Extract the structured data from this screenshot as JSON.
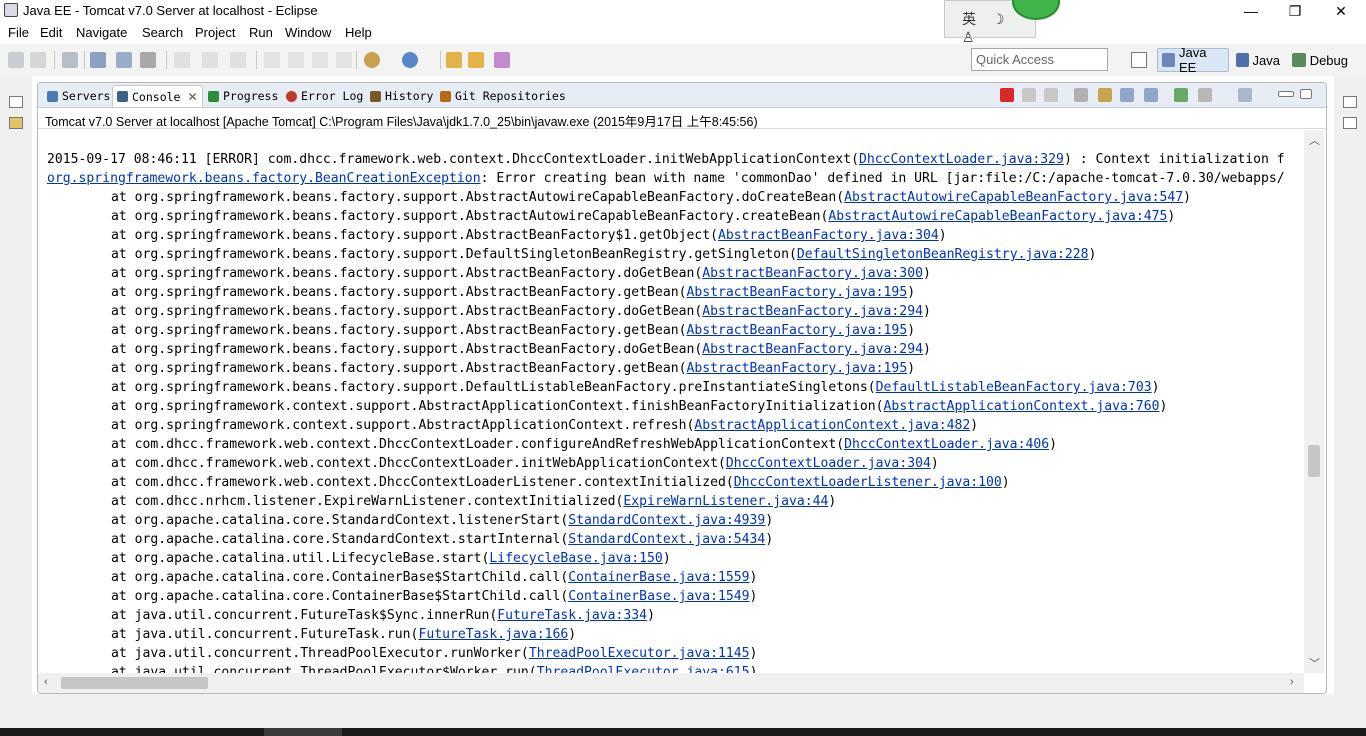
{
  "window": {
    "title": "Java EE - Tomcat v7.0 Server at localhost - Eclipse",
    "controls": {
      "minimize": "—",
      "restore": "❐",
      "close": "✕"
    }
  },
  "ime": {
    "text": "英 ☽ ♙"
  },
  "menu": [
    "File",
    "Edit",
    "Navigate",
    "Search",
    "Project",
    "Run",
    "Window",
    "Help"
  ],
  "toolbar": {
    "quick_access_placeholder": "Quick Access",
    "perspectives": [
      {
        "label": "Java EE",
        "icon": "java-ee-perspective-icon",
        "active": true
      },
      {
        "label": "Java",
        "icon": "java-perspective-icon",
        "active": false
      },
      {
        "label": "Debug",
        "icon": "debug-perspective-icon",
        "active": false
      }
    ]
  },
  "tabs": [
    {
      "label": "Servers",
      "icon": "servers-icon",
      "color": "#4a7bb7"
    },
    {
      "label": "Console",
      "icon": "console-icon",
      "color": "#3d5f8a",
      "active": true,
      "close": "✕"
    },
    {
      "label": "Progress",
      "icon": "progress-icon",
      "color": "#2e8b3a"
    },
    {
      "label": "Error Log",
      "icon": "error-log-icon",
      "color": "#c0392b"
    },
    {
      "label": "History",
      "icon": "history-icon",
      "color": "#7a5a2b"
    },
    {
      "label": "Git Repositories",
      "icon": "git-icon",
      "color": "#b56a1a"
    }
  ],
  "console": {
    "header": "Tomcat v7.0 Server at localhost [Apache Tomcat] C:\\Program Files\\Java\\jdk1.7.0_25\\bin\\javaw.exe (2015年9月17日 上午8:45:56)",
    "lines": [
      {
        "pre": "2015-09-17 08:46:11 [ERROR] com.dhcc.framework.web.context.DhccContextLoader.initWebApplicationContext(",
        "link": "DhccContextLoader.java:329",
        "post": ") : Context initialization f"
      },
      {
        "pre": "",
        "link": "org.springframework.beans.factory.BeanCreationException",
        "post": ": Error creating bean with name 'commonDao' defined in URL [jar:file:/C:/apache-tomcat-7.0.30/webapps/"
      },
      {
        "pre": "\tat org.springframework.beans.factory.support.AbstractAutowireCapableBeanFactory.doCreateBean(",
        "link": "AbstractAutowireCapableBeanFactory.java:547",
        "post": ")"
      },
      {
        "pre": "\tat org.springframework.beans.factory.support.AbstractAutowireCapableBeanFactory.createBean(",
        "link": "AbstractAutowireCapableBeanFactory.java:475",
        "post": ")"
      },
      {
        "pre": "\tat org.springframework.beans.factory.support.AbstractBeanFactory$1.getObject(",
        "link": "AbstractBeanFactory.java:304",
        "post": ")"
      },
      {
        "pre": "\tat org.springframework.beans.factory.support.DefaultSingletonBeanRegistry.getSingleton(",
        "link": "DefaultSingletonBeanRegistry.java:228",
        "post": ")"
      },
      {
        "pre": "\tat org.springframework.beans.factory.support.AbstractBeanFactory.doGetBean(",
        "link": "AbstractBeanFactory.java:300",
        "post": ")"
      },
      {
        "pre": "\tat org.springframework.beans.factory.support.AbstractBeanFactory.getBean(",
        "link": "AbstractBeanFactory.java:195",
        "post": ")"
      },
      {
        "pre": "\tat org.springframework.beans.factory.support.AbstractBeanFactory.doGetBean(",
        "link": "AbstractBeanFactory.java:294",
        "post": ")"
      },
      {
        "pre": "\tat org.springframework.beans.factory.support.AbstractBeanFactory.getBean(",
        "link": "AbstractBeanFactory.java:195",
        "post": ")"
      },
      {
        "pre": "\tat org.springframework.beans.factory.support.AbstractBeanFactory.doGetBean(",
        "link": "AbstractBeanFactory.java:294",
        "post": ")"
      },
      {
        "pre": "\tat org.springframework.beans.factory.support.AbstractBeanFactory.getBean(",
        "link": "AbstractBeanFactory.java:195",
        "post": ")"
      },
      {
        "pre": "\tat org.springframework.beans.factory.support.DefaultListableBeanFactory.preInstantiateSingletons(",
        "link": "DefaultListableBeanFactory.java:703",
        "post": ")"
      },
      {
        "pre": "\tat org.springframework.context.support.AbstractApplicationContext.finishBeanFactoryInitialization(",
        "link": "AbstractApplicationContext.java:760",
        "post": ")"
      },
      {
        "pre": "\tat org.springframework.context.support.AbstractApplicationContext.refresh(",
        "link": "AbstractApplicationContext.java:482",
        "post": ")"
      },
      {
        "pre": "\tat com.dhcc.framework.web.context.DhccContextLoader.configureAndRefreshWebApplicationContext(",
        "link": "DhccContextLoader.java:406",
        "post": ")"
      },
      {
        "pre": "\tat com.dhcc.framework.web.context.DhccContextLoader.initWebApplicationContext(",
        "link": "DhccContextLoader.java:304",
        "post": ")"
      },
      {
        "pre": "\tat com.dhcc.framework.web.context.DhccContextLoaderListener.contextInitialized(",
        "link": "DhccContextLoaderListener.java:100",
        "post": ")"
      },
      {
        "pre": "\tat com.dhcc.nrhcm.listener.ExpireWarnListener.contextInitialized(",
        "link": "ExpireWarnListener.java:44",
        "post": ")"
      },
      {
        "pre": "\tat org.apache.catalina.core.StandardContext.listenerStart(",
        "link": "StandardContext.java:4939",
        "post": ")"
      },
      {
        "pre": "\tat org.apache.catalina.core.StandardContext.startInternal(",
        "link": "StandardContext.java:5434",
        "post": ")"
      },
      {
        "pre": "\tat org.apache.catalina.util.LifecycleBase.start(",
        "link": "LifecycleBase.java:150",
        "post": ")"
      },
      {
        "pre": "\tat org.apache.catalina.core.ContainerBase$StartChild.call(",
        "link": "ContainerBase.java:1559",
        "post": ")"
      },
      {
        "pre": "\tat org.apache.catalina.core.ContainerBase$StartChild.call(",
        "link": "ContainerBase.java:1549",
        "post": ")"
      },
      {
        "pre": "\tat java.util.concurrent.FutureTask$Sync.innerRun(",
        "link": "FutureTask.java:334",
        "post": ")"
      },
      {
        "pre": "\tat java.util.concurrent.FutureTask.run(",
        "link": "FutureTask.java:166",
        "post": ")"
      },
      {
        "pre": "\tat java.util.concurrent.ThreadPoolExecutor.runWorker(",
        "link": "ThreadPoolExecutor.java:1145",
        "post": ")"
      },
      {
        "pre": "\tat java.util.concurrent.ThreadPoolExecutor$Worker.run(",
        "link": "ThreadPoolExecutor.java:615",
        "post": ")"
      }
    ]
  },
  "scroll": {
    "vertical_position": 0.63,
    "horizontal_position": 0.0
  },
  "colors": {
    "link": "#0033b3",
    "tabbar": "#e8edf5",
    "terminate_red": "#d9262a"
  }
}
